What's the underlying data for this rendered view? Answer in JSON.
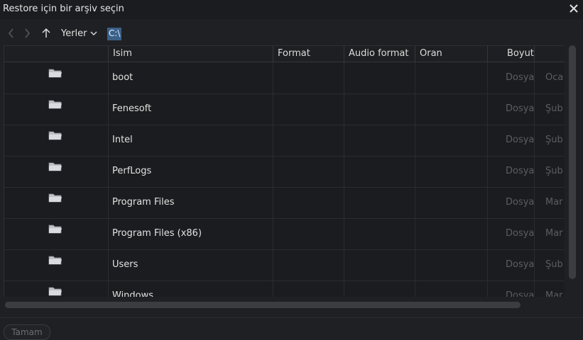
{
  "window": {
    "title": "Restore için bir arşiv seçin"
  },
  "toolbar": {
    "places_label": "Yerler",
    "path": "C:\\"
  },
  "columns": [
    "Isim",
    "Format",
    "Audio format",
    "Oran",
    "Boyut",
    ""
  ],
  "rows": [
    {
      "name": "boot",
      "size": "Dosya",
      "date": "Oca"
    },
    {
      "name": "Fenesoft",
      "size": "Dosya",
      "date": "Şub"
    },
    {
      "name": "Intel",
      "size": "Dosya",
      "date": "Şub"
    },
    {
      "name": "PerfLogs",
      "size": "Dosya",
      "date": "Şub"
    },
    {
      "name": "Program Files",
      "size": "Dosya",
      "date": "Mar"
    },
    {
      "name": "Program Files (x86)",
      "size": "Dosya",
      "date": "Mar"
    },
    {
      "name": "Users",
      "size": "Dosya",
      "date": "Şub"
    },
    {
      "name": "Windows",
      "size": "Dosya",
      "date": "Mar"
    }
  ],
  "footer": {
    "ok_label": "Tamam"
  },
  "colors": {
    "accent": "#3a6088",
    "background": "#1f2023"
  }
}
